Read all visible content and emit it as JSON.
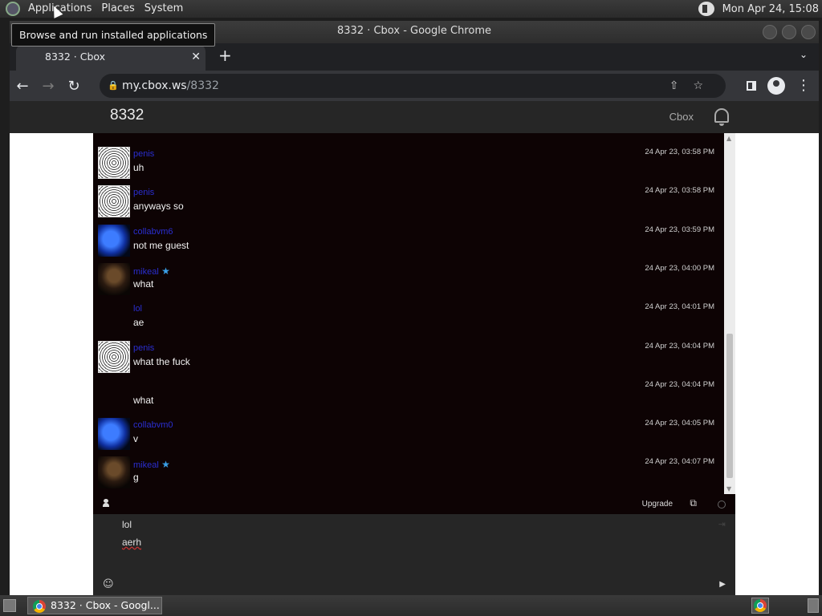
{
  "top_panel": {
    "menus": [
      "Applications",
      "Places",
      "System"
    ],
    "clock": "Mon Apr 24, 15:08"
  },
  "tooltip": "Browse and run installed applications",
  "window": {
    "title": "8332 · Cbox - Google Chrome",
    "tab_title": "8332 · Cbox",
    "url_host": "my.cbox.ws",
    "url_path": "/8332"
  },
  "page": {
    "title": "8332",
    "brand": "Cbox"
  },
  "messages": [
    {
      "user": "penis",
      "text": "uh",
      "time": "24 Apr 23, 03:58 PM",
      "avatar": "scribble",
      "star": false
    },
    {
      "user": "penis",
      "text": "anyways so",
      "time": "24 Apr 23, 03:58 PM",
      "avatar": "scribble",
      "star": false
    },
    {
      "user": "collabvm6",
      "text": "not me guest",
      "time": "24 Apr 23, 03:59 PM",
      "avatar": "blue",
      "star": false
    },
    {
      "user": "mikeal",
      "text": "what",
      "time": "24 Apr 23, 04:00 PM",
      "avatar": "dark",
      "star": true
    },
    {
      "user": "lol",
      "text": "ae",
      "time": "24 Apr 23, 04:01 PM",
      "avatar": "none",
      "star": false
    },
    {
      "user": "penis",
      "text": "what the fuck",
      "time": "24 Apr 23, 04:04 PM",
      "avatar": "scribble",
      "star": false
    },
    {
      "user": "",
      "text": "what",
      "time": "24 Apr 23, 04:04 PM",
      "avatar": "none",
      "star": false
    },
    {
      "user": "collabvm0",
      "text": "v",
      "time": "24 Apr 23, 04:05 PM",
      "avatar": "blue",
      "star": false
    },
    {
      "user": "mikeal",
      "text": "g",
      "time": "24 Apr 23, 04:07 PM",
      "avatar": "dark",
      "star": true
    }
  ],
  "statusbar": {
    "upgrade": "Upgrade"
  },
  "compose": {
    "name": "lol",
    "draft": "aerh"
  },
  "taskbar": {
    "task_label": "8332 · Cbox - Googl..."
  }
}
